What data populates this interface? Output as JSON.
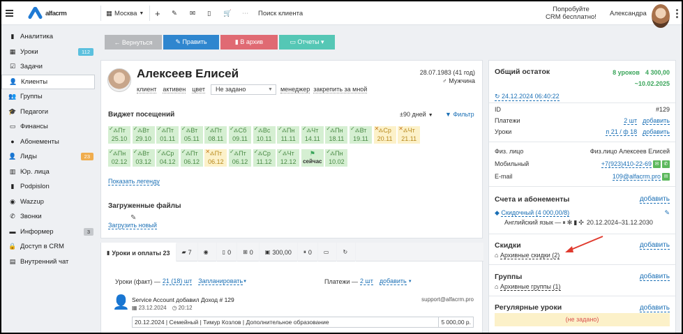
{
  "header": {
    "logo_text": "alfacrm",
    "city": "Москва",
    "search_placeholder": "Поиск клиента",
    "promo_line1": "Попробуйте",
    "promo_line2": "CRM бесплатно!",
    "user_name": "Александра"
  },
  "sidebar": {
    "items": [
      {
        "label": "Аналитика",
        "icon": "▮"
      },
      {
        "label": "Уроки",
        "icon": "▦",
        "badge": "112"
      },
      {
        "label": "Задачи",
        "icon": "☑"
      },
      {
        "label": "Клиенты",
        "icon": "👤"
      },
      {
        "label": "Группы",
        "icon": "👥"
      },
      {
        "label": "Педагоги",
        "icon": "🎓"
      },
      {
        "label": "Финансы",
        "icon": "▭"
      },
      {
        "label": "Абонементы",
        "icon": "●"
      },
      {
        "label": "Лиды",
        "icon": "👤",
        "badge": "23"
      },
      {
        "label": "Юр. лица",
        "icon": "▥"
      },
      {
        "label": "Podpislon",
        "icon": "▮"
      },
      {
        "label": "Wazzup",
        "icon": "◉"
      },
      {
        "label": "Звонки",
        "icon": "✆"
      },
      {
        "label": "Информер",
        "icon": "▬",
        "badge": "3"
      },
      {
        "label": "Доступ в CRM",
        "icon": "🔒"
      },
      {
        "label": "Внутренний чат",
        "icon": "▤"
      }
    ]
  },
  "toolbar": {
    "back": "← Вернуться",
    "edit": "✎ Править",
    "archive": "▮ В архив",
    "reports": "▭ Отчеты ▾"
  },
  "client": {
    "name": "Алексеев Елисей",
    "dob": "28.07.1983 (41 год)",
    "gender": "Мужчина",
    "tag_client": "клиент",
    "tag_active": "активен",
    "tag_color": "цвет",
    "select_value": "Не задано",
    "manager": "менеджер",
    "pin": "закрепить за мной"
  },
  "widget": {
    "title": "Виджет посещений",
    "period": "±90 дней",
    "filter": "Фильтр",
    "days": [
      {
        "d": "Пт",
        "date": "25.10",
        "s": "ok"
      },
      {
        "d": "Вт",
        "date": "29.10",
        "s": "ok"
      },
      {
        "d": "Пт",
        "date": "01.11",
        "s": "ok"
      },
      {
        "d": "Вт",
        "date": "05.11",
        "s": "ok"
      },
      {
        "d": "Пт",
        "date": "08.11",
        "s": "ok"
      },
      {
        "d": "Сб",
        "date": "09.11",
        "s": "ok"
      },
      {
        "d": "Вс",
        "date": "10.11",
        "s": "ok"
      },
      {
        "d": "Пн",
        "date": "11.11",
        "s": "ok"
      },
      {
        "d": "Чт",
        "date": "14.11",
        "s": "ok"
      },
      {
        "d": "Пн",
        "date": "18.11",
        "s": "ok"
      },
      {
        "d": "Вт",
        "date": "19.11",
        "s": "ok"
      },
      {
        "d": "Ср",
        "date": "20.11",
        "s": "warn"
      },
      {
        "d": "Чт",
        "date": "21.11",
        "s": "warn"
      },
      {
        "d": "Пн",
        "date": "02.12",
        "s": "ok"
      },
      {
        "d": "Вт",
        "date": "03.12",
        "s": "ok"
      },
      {
        "d": "Ср",
        "date": "04.12",
        "s": "ok"
      },
      {
        "d": "Пт",
        "date": "06.12",
        "s": "ok"
      },
      {
        "d": "Пт",
        "date": "06.12",
        "s": "warn"
      },
      {
        "d": "Пт",
        "date": "06.12",
        "s": "ok"
      },
      {
        "d": "Ср",
        "date": "11.12",
        "s": "ok"
      },
      {
        "d": "Чт",
        "date": "12.12",
        "s": "ok"
      },
      {
        "d": "",
        "date": "сейчас",
        "s": "now"
      },
      {
        "d": "Пн",
        "date": "10.02",
        "s": "ok"
      }
    ],
    "legend_link": "Показать легенду"
  },
  "files": {
    "title": "Загруженные файлы",
    "upload": "Загрузить новый"
  },
  "lessons": {
    "tabs": [
      {
        "label": "Уроки и оплаты 23",
        "icon": "▮"
      },
      {
        "label": "7",
        "icon": "▰"
      },
      {
        "label": "",
        "icon": "◉"
      },
      {
        "label": "0",
        "icon": "▯"
      },
      {
        "label": "0",
        "icon": "⊞"
      },
      {
        "label": "300,00",
        "icon": "▣"
      },
      {
        "label": "0",
        "icon": "⏸"
      },
      {
        "label": "",
        "icon": "▭"
      },
      {
        "label": "",
        "icon": "↻"
      }
    ],
    "fact_label": "Уроки (факт) —",
    "fact_value": "21 (18) шт",
    "plan": "Запланировать",
    "pay_label": "Платежи —",
    "pay_value": "2 шт",
    "add": "добавить",
    "event_text": "Service Account добавил Доход # 129",
    "event_date": "23.12.2024",
    "event_time": "20:12",
    "event_email": "support@alfacrm.pro",
    "detail": "20.12.2024 | Семейный | Тимур Козлов | Дополнительное образование",
    "amount": "5 000,00 р."
  },
  "balance": {
    "title": "Общий остаток",
    "lessons": "8 уроков",
    "money": "4 300,00",
    "until": "~10.02.2025",
    "datetime": "24.12.2024 06:40:22",
    "id_label": "ID",
    "id_value": "#129",
    "payments_label": "Платежи",
    "payments_value": "2 шт",
    "lessons_label": "Уроки",
    "lessons_value": "п 21 / ф 18",
    "add": "добавить",
    "person_label": "Физ. лицо",
    "person_value": "Физ.лицо Алексеев Елисей",
    "mobile_label": "Мобильный",
    "mobile_value": "+7(923)410-22-69",
    "email_label": "E-mail",
    "email_value": "109@alfacrm.pro"
  },
  "subscriptions": {
    "title": "Счета и абонементы",
    "add": "добавить",
    "name": "Скидочный (4 000,00/8)",
    "detail": "Английский язык — ",
    "period": "20.12.2024–31.12.2030"
  },
  "discounts": {
    "title": "Скидки",
    "add": "добавить",
    "archive": "Архивные скидки (2)"
  },
  "groups": {
    "title": "Группы",
    "add": "добавить",
    "archive": "Архивные группы (1)"
  },
  "regular": {
    "title": "Регулярные уроки",
    "add": "добавить",
    "empty": "(не задано)"
  },
  "colors": {
    "blue": "#1f7ad4",
    "green": "#5cb85c",
    "red": "#e06a73",
    "teal": "#55c7b5",
    "gray": "#b7b9bc",
    "annotation_arrow": "#e03a2e"
  }
}
